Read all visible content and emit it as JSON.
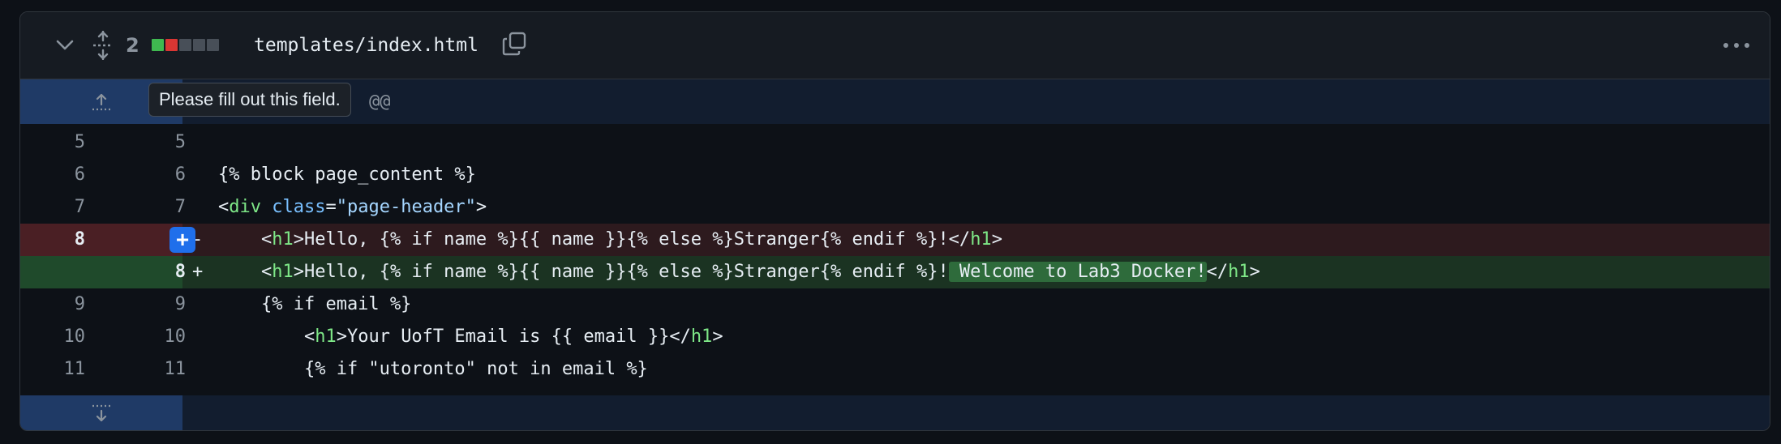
{
  "header": {
    "changed_count": "2",
    "diffstat_colors": [
      "#3fb950",
      "#da3633",
      "#484f58",
      "#484f58",
      "#484f58"
    ],
    "filename": "templates/index.html",
    "icons": {
      "collapse": "chevron-down-icon",
      "expand_all": "unfold-icon",
      "copy": "copy-icon",
      "more": "kebab-horizontal-icon"
    }
  },
  "hunk": {
    "header_visible_text": "@@",
    "expand_up_icon": "expand-up-icon",
    "expand_down_icon": "expand-down-icon"
  },
  "tooltip": {
    "text": "Please fill out this field."
  },
  "lines": [
    {
      "old": "5",
      "new": "5",
      "marker": "",
      "code": ""
    },
    {
      "old": "6",
      "new": "6",
      "marker": "",
      "code": "{% block page_content %}"
    },
    {
      "old": "7",
      "new": "7",
      "marker": "",
      "code_parts": [
        "<",
        "div",
        " ",
        "class",
        "=",
        "\"page-header\"",
        ">"
      ]
    },
    {
      "old": "8",
      "new": "",
      "marker": "-",
      "code_parts": [
        "    <",
        "h1",
        ">Hello, {% if name %}{{ name }}{% else %}Stranger{% endif %}!</",
        "h1",
        ">"
      ]
    },
    {
      "old": "",
      "new": "8",
      "marker": "+",
      "code_parts": [
        "    <",
        "h1",
        ">Hello, {% if name %}{{ name }}{% else %}Stranger{% endif %}!",
        " Welcome to Lab3 Docker!",
        "</",
        "h1",
        ">"
      ]
    },
    {
      "old": "9",
      "new": "9",
      "marker": "",
      "code": "    {% if email %}"
    },
    {
      "old": "10",
      "new": "10",
      "marker": "",
      "code_parts": [
        "        <",
        "h1",
        ">Your UofT Email is {{ email }}</",
        "h1",
        ">"
      ]
    },
    {
      "old": "11",
      "new": "11",
      "marker": "",
      "code": "        {% if \"utoronto\" not in email %}"
    }
  ],
  "add_line_button": "+"
}
